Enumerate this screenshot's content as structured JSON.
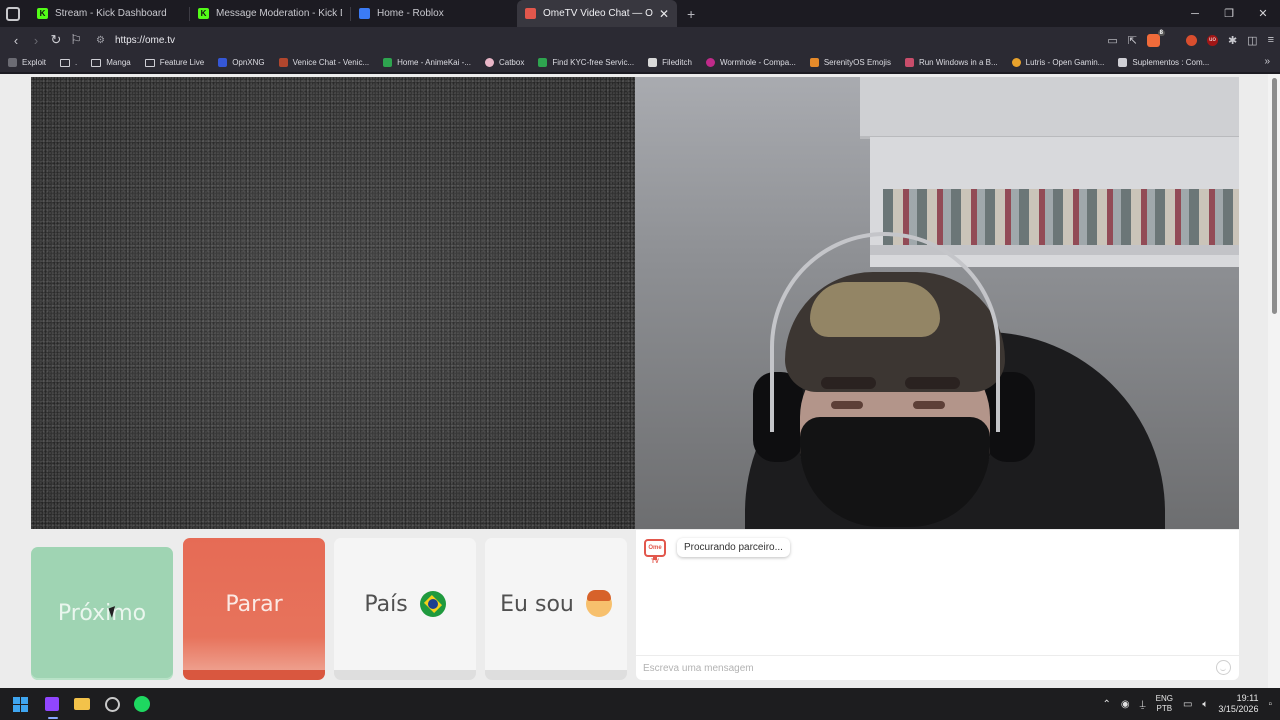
{
  "browser": {
    "tabs": [
      {
        "title": "Stream - Kick Dashboard",
        "icon": "kick-icon",
        "color": "#53fc18",
        "active": false
      },
      {
        "title": "Message Moderation - Kick Dashboard",
        "icon": "kick-icon",
        "color": "#53fc18",
        "active": false
      },
      {
        "title": "Home - Roblox",
        "icon": "roblox-icon",
        "color": "#3b7bf5",
        "active": false
      },
      {
        "title": "OmeTV Video Chat — Omegle",
        "icon": "ometv-icon",
        "color": "#e2574c",
        "active": true
      }
    ],
    "url": "https://ome.tv",
    "bookmarks": [
      {
        "label": "Exploit",
        "icon": "exploit-icon"
      },
      {
        "label": ".",
        "icon": "folder-icon"
      },
      {
        "label": "Manga",
        "icon": "folder-icon"
      },
      {
        "label": "Feature Live",
        "icon": "folder-icon"
      },
      {
        "label": "OpnXNG",
        "icon": "opnxng-icon"
      },
      {
        "label": "Venice Chat - Venic...",
        "icon": "venice-icon"
      },
      {
        "label": "Home - AnimeKai -...",
        "icon": "animekai-icon"
      },
      {
        "label": "Catbox",
        "icon": "catbox-icon"
      },
      {
        "label": "Find KYC-free Servic...",
        "icon": "kyc-icon"
      },
      {
        "label": "Fileditch",
        "icon": "fileditch-icon"
      },
      {
        "label": "Wormhole - Compa...",
        "icon": "wormhole-icon"
      },
      {
        "label": "SerenityOS Emojis",
        "icon": "serenity-icon"
      },
      {
        "label": "Run Windows in a B...",
        "icon": "windows-icon"
      },
      {
        "label": "Lutris - Open Gamin...",
        "icon": "lutris-icon"
      },
      {
        "label": "Suplementos : Com...",
        "icon": "suplementos-icon"
      }
    ]
  },
  "ometv": {
    "buttons": {
      "next": "Próximo",
      "stop": "Parar",
      "country": "País",
      "i_am": "Eu sou"
    },
    "chat": {
      "status_message": "Procurando parceiro...",
      "input_placeholder": "Escreva uma mensagem",
      "logo_text": "Ome TV"
    }
  },
  "taskbar": {
    "language": "ENG",
    "layout": "PTB",
    "time": "19:11",
    "date": "3/15/2026"
  }
}
